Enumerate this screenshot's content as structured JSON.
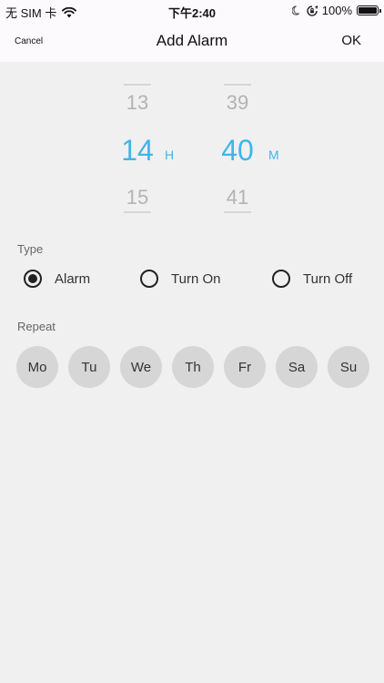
{
  "status_bar": {
    "carrier": "无 SIM 卡",
    "time": "下午2:40",
    "battery": "100%"
  },
  "nav": {
    "cancel_label": "Cancel",
    "title": "Add Alarm",
    "ok_label": "OK"
  },
  "picker": {
    "hours": {
      "prev": "13",
      "selected": "14",
      "next": "15",
      "unit": "H"
    },
    "minutes": {
      "prev": "39",
      "selected": "40",
      "next": "41",
      "unit": "M"
    }
  },
  "type": {
    "label": "Type",
    "selected": "Alarm",
    "options": [
      "Alarm",
      "Turn On",
      "Turn Off"
    ]
  },
  "repeat": {
    "label": "Repeat",
    "days": [
      "Mo",
      "Tu",
      "We",
      "Th",
      "Fr",
      "Sa",
      "Su"
    ]
  },
  "colors": {
    "accent": "#3fb6e8",
    "background": "#f0f0f0",
    "bar_background": "#fdfafd",
    "day_button": "#d6d6d6"
  }
}
